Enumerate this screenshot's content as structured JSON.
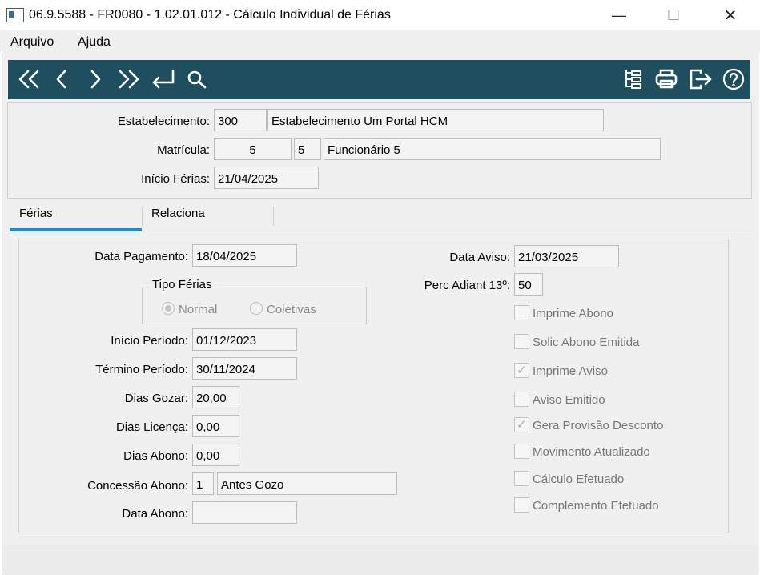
{
  "window": {
    "title": "06.9.5588 - FR0080 - 1.02.01.012 - Cálculo Individual de Férias",
    "minimize": "—",
    "maximize": "☐",
    "close": "✕"
  },
  "menu": {
    "items": [
      "Arquivo",
      "Ajuda"
    ]
  },
  "toolbar": {
    "buttons": [
      "first-icon",
      "previous-icon",
      "next-icon",
      "last-icon",
      "goto-icon",
      "search-icon",
      "tree-icon",
      "print-icon",
      "exit-icon",
      "help-icon"
    ],
    "bg_color": "#1f4f5e"
  },
  "header": {
    "estabelecimento": {
      "label": "Estabelecimento:",
      "code": "300",
      "name": "Estabelecimento Um Portal HCM"
    },
    "matricula": {
      "label": "Matrícula:",
      "value": "5",
      "digit": "5",
      "name": "Funcionário 5"
    },
    "inicio_ferias": {
      "label": "Início Férias:",
      "value": "21/04/2025"
    }
  },
  "tabs": [
    {
      "label": "Férias",
      "selected": true
    },
    {
      "label": "Relaciona",
      "selected": false
    }
  ],
  "ferias": {
    "data_pagamento": {
      "label": "Data Pagamento:",
      "value": "18/04/2025"
    },
    "tipo_ferias": {
      "title": "Tipo Férias",
      "options": [
        "Normal",
        "Coletivas"
      ],
      "selected": "Normal"
    },
    "inicio_periodo": {
      "label": "Início Período:",
      "value": "01/12/2023"
    },
    "termino_periodo": {
      "label": "Término Período:",
      "value": "30/11/2024"
    },
    "dias_gozar": {
      "label": "Dias Gozar:",
      "value": "20,00"
    },
    "dias_licenca": {
      "label": "Dias Licença:",
      "value": "0,00"
    },
    "dias_abono": {
      "label": "Dias Abono:",
      "value": "0,00"
    },
    "concessao_abono": {
      "label": "Concessão Abono:",
      "code": "1",
      "name": "Antes Gozo"
    },
    "data_abono": {
      "label": "Data Abono:",
      "value": ""
    },
    "data_aviso": {
      "label": "Data Aviso:",
      "value": "21/03/2025"
    },
    "perc_adiant": {
      "label": "Perc Adiant 13º:",
      "value": "50"
    },
    "checkboxes": [
      {
        "label": "Imprime Abono",
        "checked": false
      },
      {
        "label": "Solic Abono Emitida",
        "checked": false
      },
      {
        "label": "Imprime Aviso",
        "checked": true
      },
      {
        "label": "Aviso Emitido",
        "checked": false
      },
      {
        "label": "Gera Provisão Desconto",
        "checked": true
      },
      {
        "label": "Movimento Atualizado",
        "checked": false
      },
      {
        "label": "Cálculo Efetuado",
        "checked": false
      },
      {
        "label": "Complemento Efetuado",
        "checked": false
      }
    ]
  },
  "colors": {
    "accent": "#1a8bd6",
    "toolbar": "#1f4f5e"
  }
}
